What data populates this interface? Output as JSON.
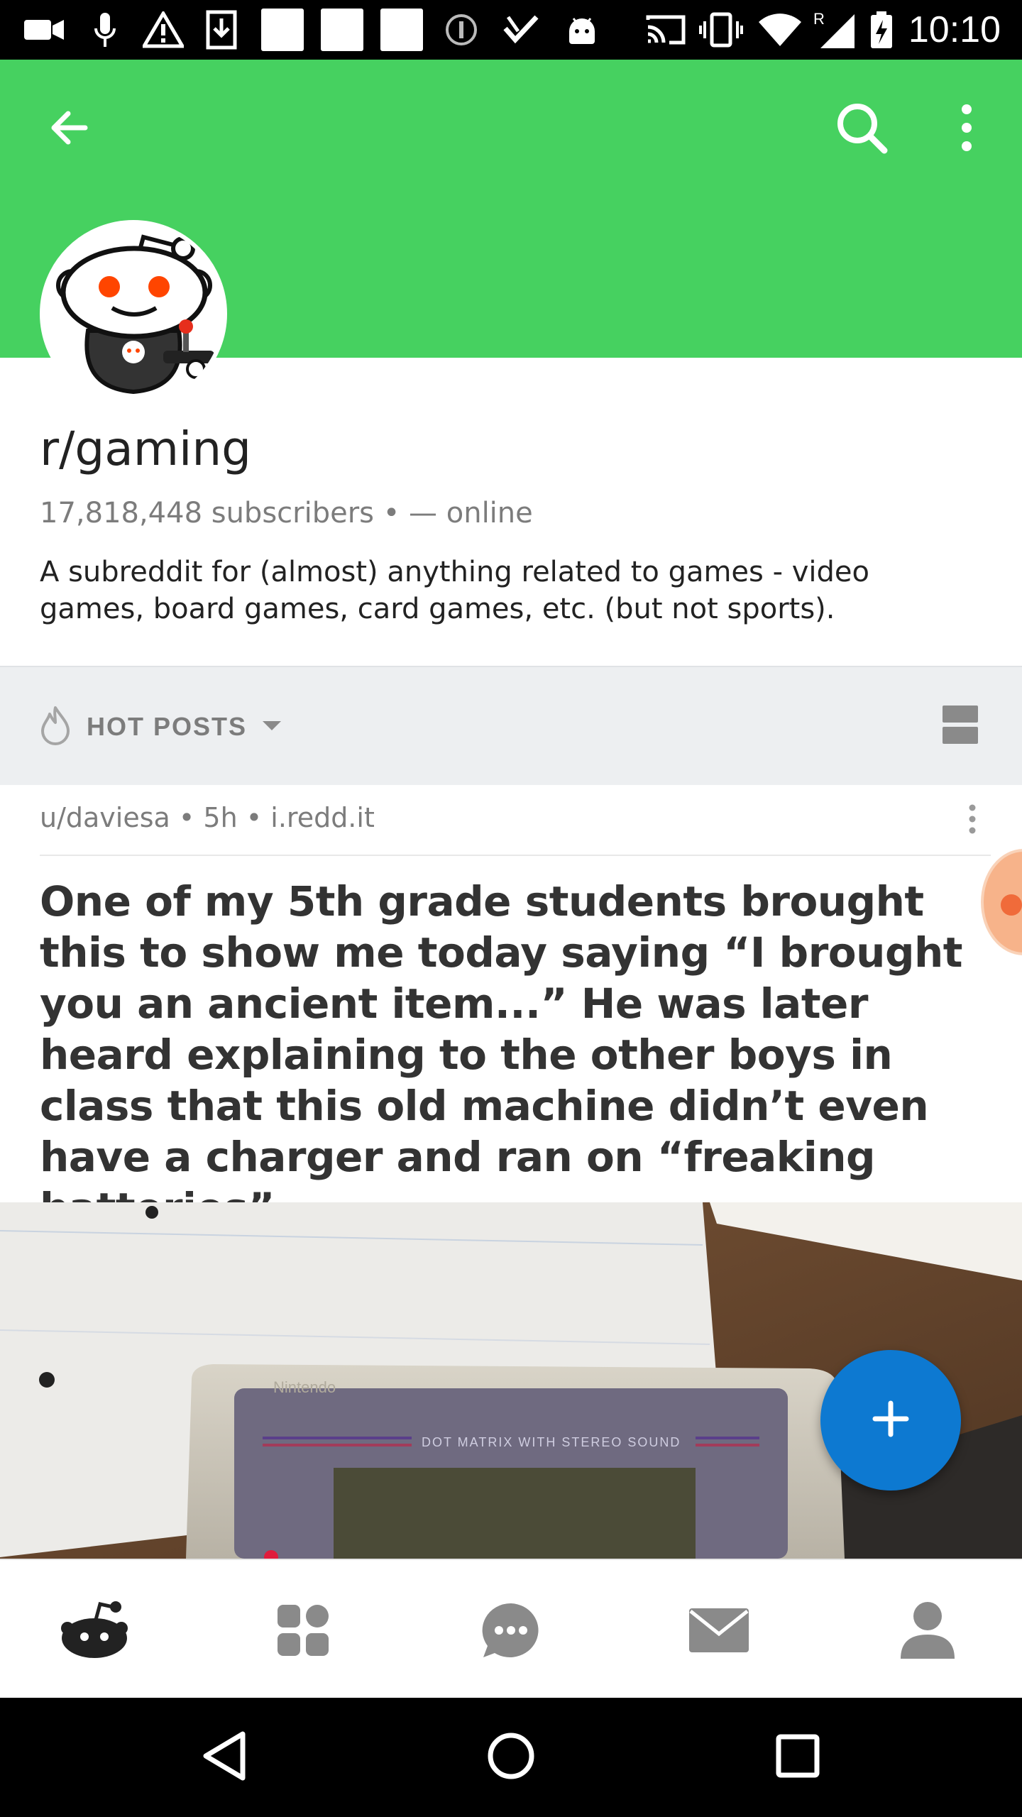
{
  "status_bar": {
    "time": "10:10",
    "network_badge": "R"
  },
  "header": {
    "back_icon": "arrow-left-icon",
    "search_icon": "search-icon",
    "more_icon": "more-vertical-icon",
    "color": "#46d160"
  },
  "subreddit": {
    "name": "r/gaming",
    "subscribers": "17,818,448 subscribers",
    "separator": "•",
    "online": "— online",
    "description": "A subreddit for (almost) anything related to games - video games, board games, card games, etc. (but not sports)."
  },
  "sort": {
    "label": "HOT POSTS",
    "icon": "flame-icon",
    "view_icon": "card-view-icon"
  },
  "post": {
    "author": "u/daviesa",
    "age": "5h",
    "domain": "i.redd.it",
    "title": "One of my 5th grade students brought this to show me today saying “I brought you an ancient item...” He was later heard explaining to the other boys in class that this old machine didn’t even have a charger and ran on “freaking batteries”.",
    "image_text_brand": "Nintendo",
    "image_text_screen": "DOT MATRIX WITH STEREO SOUND"
  },
  "fab": {
    "icon": "plus-icon",
    "color": "#0d79d1"
  },
  "bottom_nav": {
    "items": [
      {
        "icon": "reddit-home-icon",
        "active": true
      },
      {
        "icon": "communities-grid-icon",
        "active": false
      },
      {
        "icon": "chat-icon",
        "active": false
      },
      {
        "icon": "inbox-mail-icon",
        "active": false
      },
      {
        "icon": "profile-icon",
        "active": false
      }
    ]
  },
  "system_nav": {
    "items": [
      "back-triangle-icon",
      "home-circle-icon",
      "recents-square-icon"
    ]
  }
}
